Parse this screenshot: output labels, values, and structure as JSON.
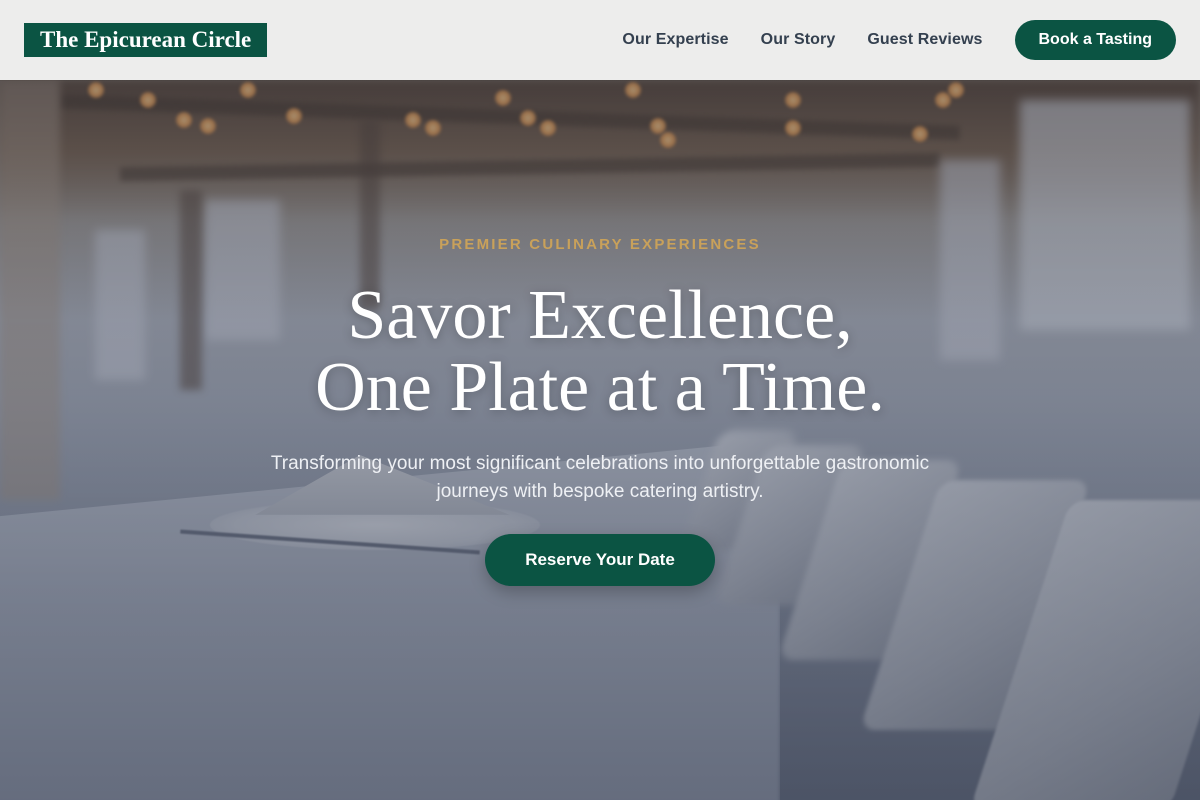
{
  "header": {
    "logo": "The Epicurean Circle",
    "nav": [
      {
        "label": "Our Expertise"
      },
      {
        "label": "Our Story"
      },
      {
        "label": "Guest Reviews"
      }
    ],
    "cta_label": "Book a Tasting"
  },
  "hero": {
    "eyebrow": "PREMIER CULINARY EXPERIENCES",
    "headline_line1": "Savor Excellence,",
    "headline_line2": "One Plate at a Time.",
    "subtext": "Transforming your most significant celebrations into unforgettable gastronomic journeys with bespoke catering artistry.",
    "cta_label": "Reserve Your Date",
    "background": "banquet-hall-photo"
  },
  "colors": {
    "brand_green": "#0b5443",
    "accent_gold": "#c9a15a",
    "nav_text": "#34404f",
    "header_bg": "#f4f4f3"
  }
}
